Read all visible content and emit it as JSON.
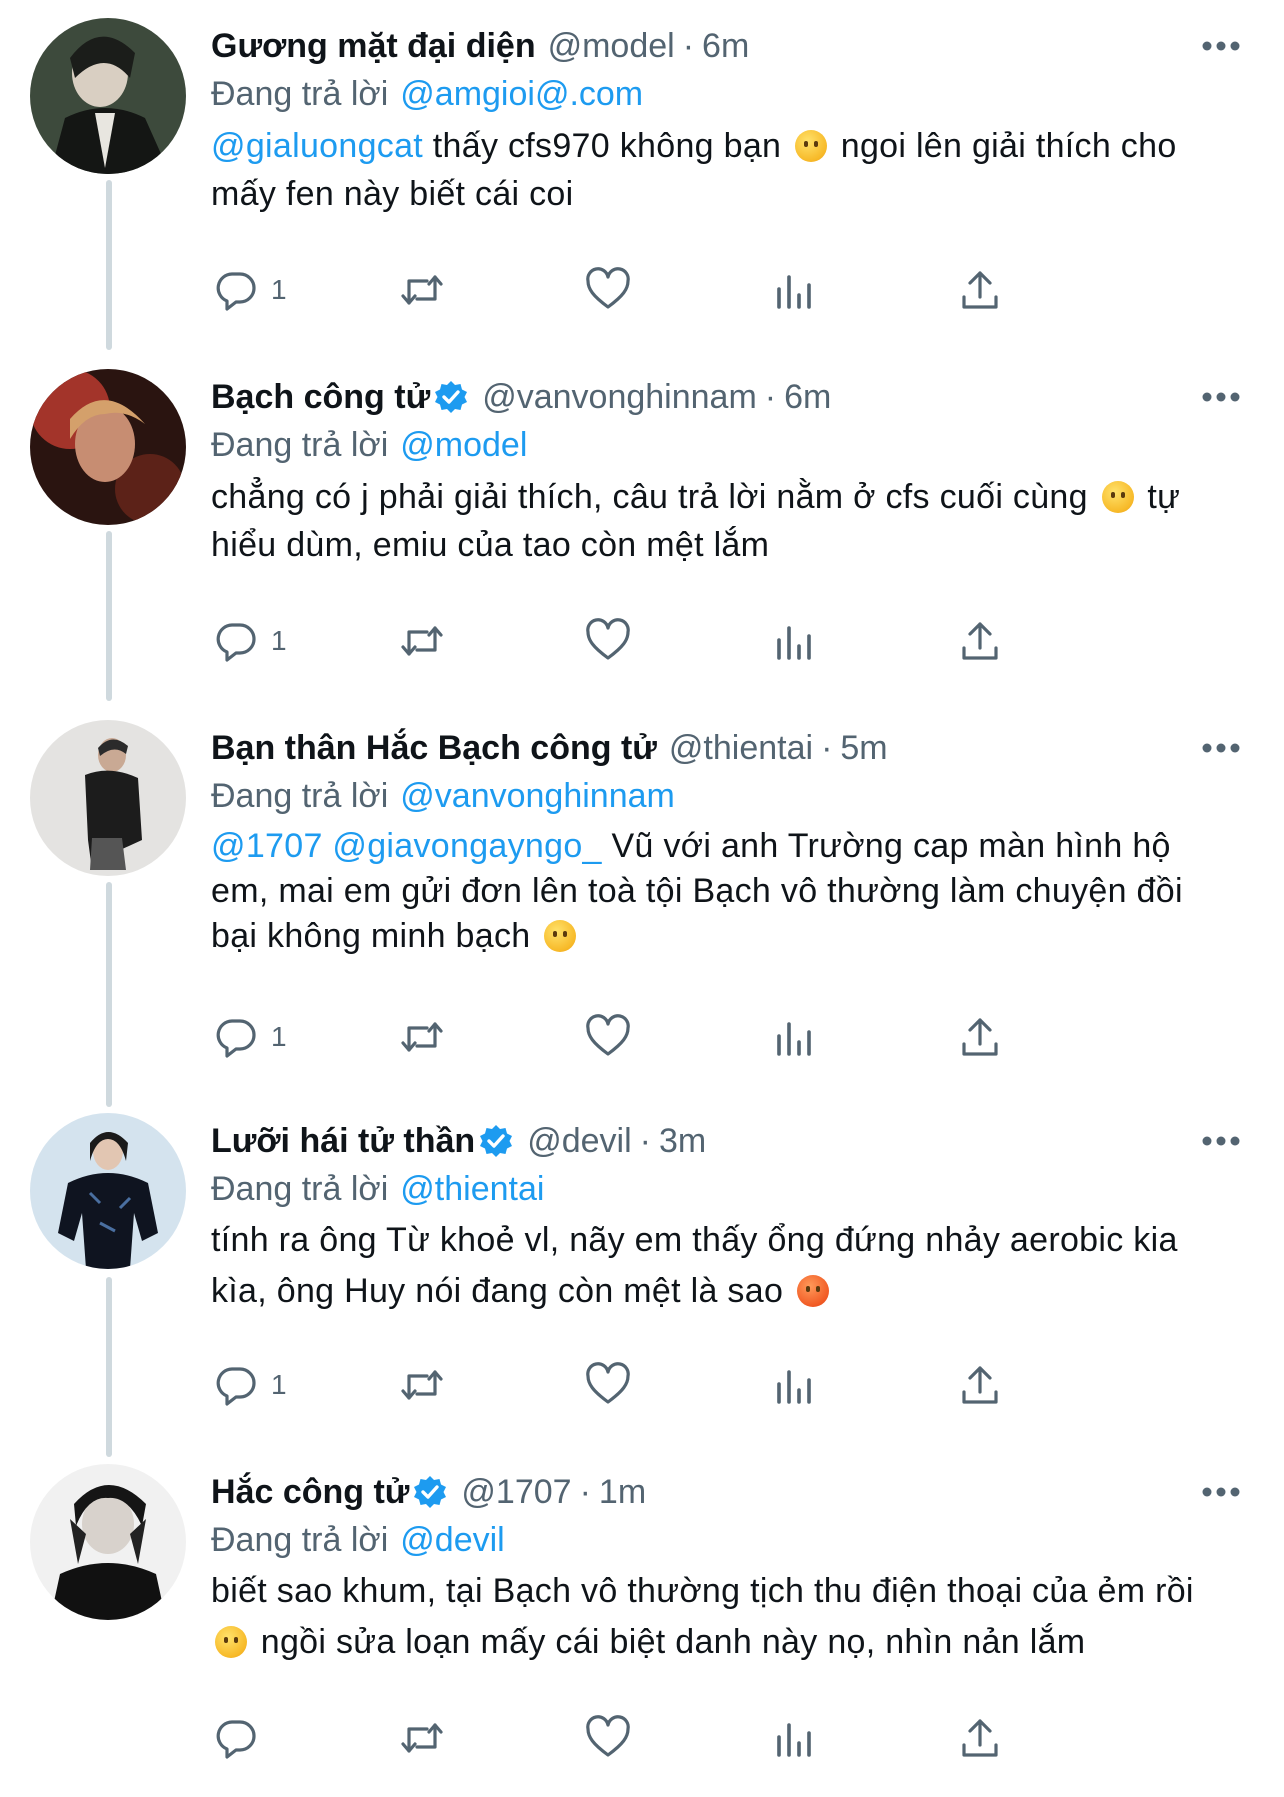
{
  "replying_label": "Đang trả lời",
  "tweets": [
    {
      "name": "Gương mặt đại diện",
      "verified": false,
      "handle": "@model",
      "time": "6m",
      "replying_to": "@amgioi@.com",
      "mentions": "@gialuongcat",
      "text_a": " thấy cfs970 không bạn ",
      "text_b": " ngoi lên giải thích cho mấy fen này biết cái coi",
      "reply_count": "1"
    },
    {
      "name": "Bạch công tử",
      "verified": true,
      "handle": "@vanvonghinnam",
      "time": "6m",
      "replying_to": "@model",
      "text_a": "chẳng có j phải giải thích, câu trả lời nằm ở cfs cuối cùng ",
      "text_b": " tự hiểu dùm, emiu của tao còn mệt lắm",
      "reply_count": "1"
    },
    {
      "name": "Bạn thân Hắc Bạch công tử",
      "verified": false,
      "handle": "@thientai",
      "time": "5m",
      "replying_to": "@vanvonghinnam",
      "mentions": "@1707 @giavongayngo_",
      "text_a": " Vũ với anh Trường cap màn hình hộ em, mai em gửi đơn lên toà tội Bạch vô thường làm chuyện đồi bại không minh bạch ",
      "reply_count": "1"
    },
    {
      "name": "Lưỡi hái tử thần",
      "verified": true,
      "handle": "@devil",
      "time": "3m",
      "replying_to": "@thientai",
      "text_a": "tính ra ông Từ khoẻ vl, nãy em thấy ổng đứng nhảy aerobic kia kìa, ông Huy nói đang còn mệt là sao ",
      "reply_count": "1"
    },
    {
      "name": "Hắc công tử",
      "verified": true,
      "handle": "@1707",
      "time": "1m",
      "replying_to": "@devil",
      "text_a": "biết sao khum, tại Bạch vô thường tịch thu điện thoại của ẻm rồi ",
      "text_b": " ngồi sửa loạn mấy cái biệt danh này nọ, nhìn nản lắm",
      "reply_count": ""
    }
  ],
  "icons": {
    "reply": "reply-bubble-icon",
    "retweet": "retweet-icon",
    "like": "heart-icon",
    "views": "bar-chart-icon",
    "share": "share-upload-icon",
    "more": "more-dots-icon",
    "verified": "verified-badge-icon"
  },
  "colors": {
    "link": "#1d9bf0",
    "secondary": "#536471",
    "text": "#0f1419",
    "thread_line": "#cfd9de"
  }
}
